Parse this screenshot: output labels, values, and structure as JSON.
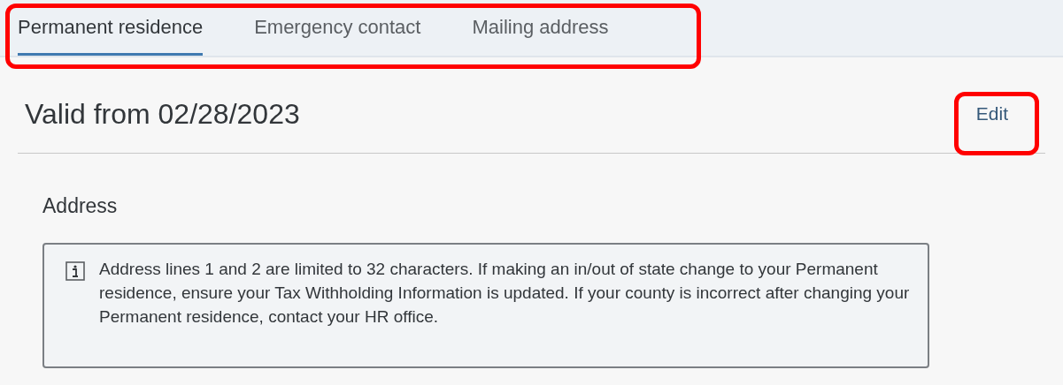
{
  "tabs": [
    {
      "label": "Permanent residence",
      "selected": true
    },
    {
      "label": "Emergency contact",
      "selected": false
    },
    {
      "label": "Mailing address",
      "selected": false
    }
  ],
  "header": {
    "title": "Valid from 02/28/2023",
    "edit_label": "Edit"
  },
  "section": {
    "title": "Address",
    "message": "Address lines 1 and 2 are limited to 32 characters. If making an in/out of state change to your Permanent residence, ensure your Tax Withholding Information is updated. If your county is incorrect after changing your Permanent residence, contact your HR office."
  }
}
